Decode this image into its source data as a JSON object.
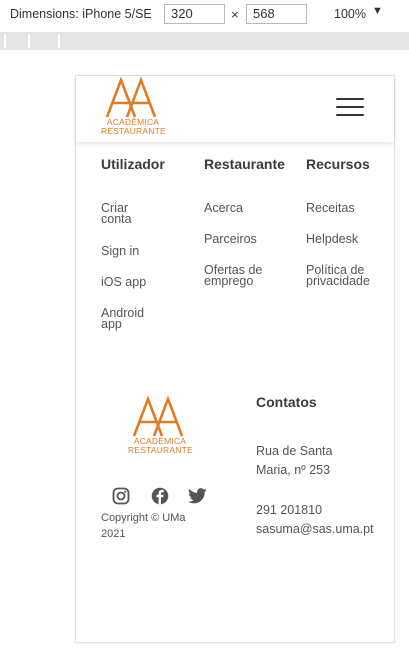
{
  "devtools": {
    "dimensions_label": "Dimensions: iPhone 5/SE",
    "width_value": "320",
    "times_symbol": "×",
    "height_value": "568",
    "zoom_label": "100%",
    "zoom_caret": "▼"
  },
  "brand": {
    "line1": "ACADÉMICA",
    "line2": "RESTAURANTE",
    "accent_color": "#e07c24"
  },
  "footer": {
    "columns": [
      {
        "title": "Utilizador",
        "links": [
          "Criar conta",
          "Sign in",
          "iOS app",
          "Android app"
        ]
      },
      {
        "title": "Restaurante",
        "links": [
          "Acerca",
          "Parceiros",
          "Ofertas de emprego"
        ]
      },
      {
        "title": "Recursos",
        "links": [
          "Receitas",
          "Helpdesk",
          "Política de privacidade"
        ]
      }
    ],
    "contacts": {
      "title": "Contatos",
      "address_line1": "Rua de Santa",
      "address_line2": "Maria, nº 253",
      "phone": "291 201810",
      "email": "sasuma@sas.uma.pt"
    },
    "social_icons": [
      "instagram-icon",
      "facebook-icon",
      "twitter-icon"
    ],
    "copyright_line1": "Copyright © UMa",
    "copyright_line2": "2021"
  }
}
